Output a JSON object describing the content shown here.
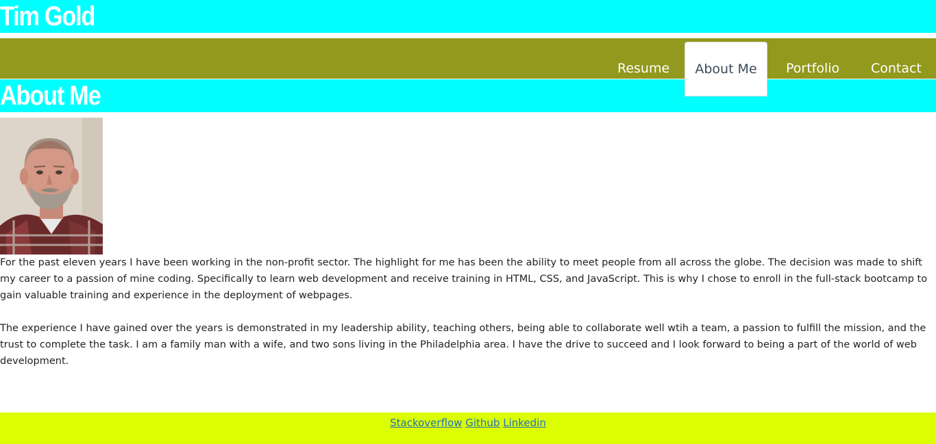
{
  "header": {
    "title": "Tim Gold",
    "background": "#00ffff"
  },
  "nav": {
    "background": "#92991d",
    "items": [
      {
        "label": "Resume",
        "active": false
      },
      {
        "label": "About Me",
        "active": true
      },
      {
        "label": "Portfolio",
        "active": false
      },
      {
        "label": "Contact",
        "active": false
      }
    ]
  },
  "section": {
    "title": "About Me",
    "photo_alt": "profile-photo"
  },
  "bio": {
    "paragraphs": [
      "For the past eleven years I have been working in the non-profit sector. The highlight for me has been the ability to meet people from all across the globe. The decision was made to shift my career to a passion of mine coding. Specifically to learn web development and receive training in HTML, CSS, and JavaScript. This is why I chose to enroll in the full-stack bootcamp to gain valuable training and experience in the deployment of webpages.",
      "The experience I have gained over the years is demonstrated in my leadership ability, teaching others, being able to collaborate well wtih a team, a passion to fulfill the mission, and the trust to complete the task. I am a family man with a wife, and two sons living in the Philadelphia area. I have the drive to succeed and I look forward to being a part of the world of web development."
    ]
  },
  "footer": {
    "background": "#dbff00",
    "links": [
      "Stackoverflow",
      "Github",
      "Linkedin"
    ]
  }
}
